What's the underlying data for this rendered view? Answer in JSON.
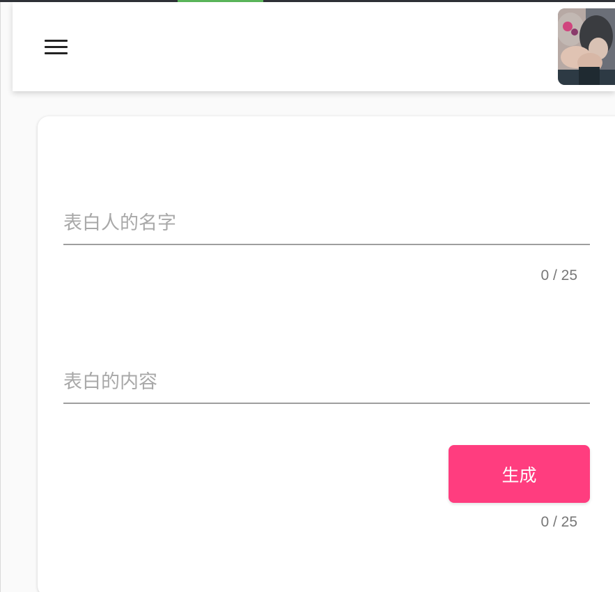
{
  "colors": {
    "accent": "#ff3d7f",
    "top_strip_accent": "#5cb85c",
    "header_bg": "#ffffff"
  },
  "header": {
    "menu_icon": "hamburger-menu-icon",
    "avatar_icon": "user-avatar-photo"
  },
  "form": {
    "name_field": {
      "placeholder": "表白人的名字",
      "value": "",
      "counter": "0 / 25"
    },
    "content_field": {
      "placeholder": "表白的内容",
      "value": "",
      "counter": "0 / 25"
    },
    "generate_label": "生成"
  }
}
